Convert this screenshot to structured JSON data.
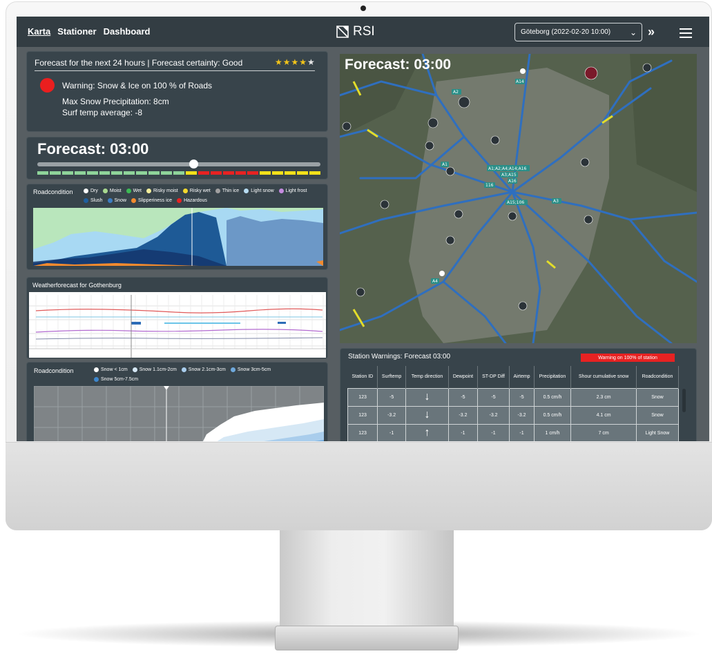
{
  "nav": {
    "links": [
      "Karta",
      "Stationer",
      "Dashboard"
    ]
  },
  "brand": {
    "name": "RSI"
  },
  "location_select": {
    "value": "Göteborg  (2022-02-20 10:00)"
  },
  "summary": {
    "title": "Forecast for the next 24 hours | Forecast certainty: Good",
    "stars_filled": "★★★★",
    "stars_empty": "★",
    "rating": 4,
    "warning": "Warning: Snow & Ice on 100 % of Roads",
    "max_snow": "Max Snow Precipitation: 8cm",
    "surf_temp": "Surf temp average: -8"
  },
  "forecast_time": {
    "title": "Forecast: 03:00",
    "slider_fraction": 0.55,
    "segments": [
      "#8ed39a",
      "#8ed39a",
      "#8ed39a",
      "#8ed39a",
      "#8ed39a",
      "#8ed39a",
      "#8ed39a",
      "#8ed39a",
      "#8ed39a",
      "#8ed39a",
      "#8ed39a",
      "#8ed39a",
      "#f2e01a",
      "#e72222",
      "#e72222",
      "#e72222",
      "#e72222",
      "#e72222",
      "#f2e01a",
      "#f2e01a",
      "#f2e01a",
      "#f2e01a",
      "#f2e01a"
    ]
  },
  "road1": {
    "title": "Roadcondition",
    "legend": [
      {
        "label": "Dry",
        "color": "#ffffff"
      },
      {
        "label": "Moist",
        "color": "#a9d98f"
      },
      {
        "label": "Wet",
        "color": "#3dbb55"
      },
      {
        "label": "Risky moist",
        "color": "#f3ee9c"
      },
      {
        "label": "Risky wet",
        "color": "#f3d82d"
      },
      {
        "label": "Thin ice",
        "color": "#a0a0a0"
      },
      {
        "label": "Light snow",
        "color": "#b7dcf2"
      },
      {
        "label": "Light frost",
        "color": "#c58be0"
      },
      {
        "label": "Slush",
        "color": "#1f5f9f"
      },
      {
        "label": "Snow",
        "color": "#3d7dc2"
      },
      {
        "label": "Slipperiness ice",
        "color": "#f28a2e"
      },
      {
        "label": "Hazardous",
        "color": "#e72222"
      }
    ]
  },
  "weather": {
    "title": "Weatherforecast for Gothenburg"
  },
  "road2": {
    "title": "Roadcondition",
    "legend": [
      {
        "label": "Snow < 1cm",
        "color": "#ffffff"
      },
      {
        "label": "Snow 1.1cm-2cm",
        "color": "#d6e8f5"
      },
      {
        "label": "Snow 2.1cm-3cm",
        "color": "#a9cdec"
      },
      {
        "label": "Snow 3cm-5cm",
        "color": "#6fa9dc"
      },
      {
        "label": "Snow 5cm-7.5cm",
        "color": "#3d86cc"
      }
    ]
  },
  "map": {
    "title": "Forecast: 03:00",
    "road_labels": [
      "A1;A2;A4;A14;A16",
      "A3;A15",
      "A16",
      "A15;106",
      "A14",
      "A2",
      "A3",
      "A4",
      "A1",
      "116"
    ]
  },
  "stations": {
    "title": "Station Warnings: Forecast 03:00",
    "badge": "Warning on 100% of station",
    "columns": [
      "Station ID",
      "Surftemp",
      "Temp direction",
      "Dewpoint",
      "ST-DP Diff",
      "Airtemp",
      "Precipitation",
      "Shour cumulative snow",
      "Roadcondition"
    ],
    "rows": [
      [
        "123",
        "-5",
        "↓",
        "-5",
        "-5",
        "-5",
        "0.5 cm/h",
        "2.3 cm",
        "Snow"
      ],
      [
        "123",
        "-3.2",
        "↓",
        "-3.2",
        "-3.2",
        "-3.2",
        "0.5 cm/h",
        "4.1 cm",
        "Snow"
      ],
      [
        "123",
        "-1",
        "↑",
        "-1",
        "-1",
        "-1",
        "1 cm/h",
        "7 cm",
        "Light Snow"
      ]
    ]
  }
}
